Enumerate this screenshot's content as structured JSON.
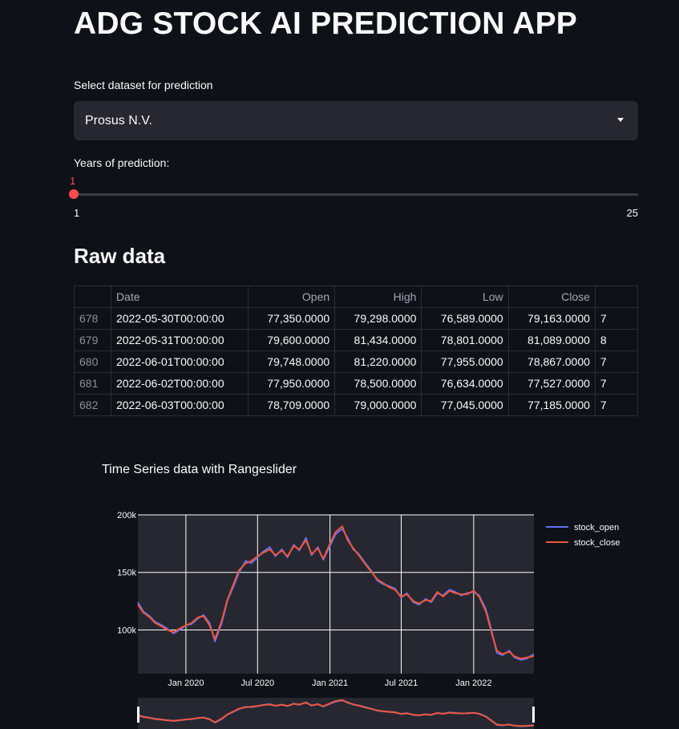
{
  "app_title": "ADG STOCK AI PREDICTION APP",
  "dataset": {
    "label": "Select dataset for prediction",
    "selected": "Prosus N.V."
  },
  "years": {
    "label": "Years of prediction:",
    "value": "1",
    "min": "1",
    "max": "25"
  },
  "raw_section": {
    "title": "Raw data"
  },
  "table": {
    "columns": [
      "",
      "Date",
      "Open",
      "High",
      "Low",
      "Close",
      ""
    ],
    "rows": [
      [
        "678",
        "2022-05-30T00:00:00",
        "77,350.0000",
        "79,298.0000",
        "76,589.0000",
        "79,163.0000",
        "7"
      ],
      [
        "679",
        "2022-05-31T00:00:00",
        "79,600.0000",
        "81,434.0000",
        "78,801.0000",
        "81,089.0000",
        "8"
      ],
      [
        "680",
        "2022-06-01T00:00:00",
        "79,748.0000",
        "81,220.0000",
        "77,955.0000",
        "78,867.0000",
        "7"
      ],
      [
        "681",
        "2022-06-02T00:00:00",
        "77,950.0000",
        "78,500.0000",
        "76,634.0000",
        "77,527.0000",
        "7"
      ],
      [
        "682",
        "2022-06-03T00:00:00",
        "78,709.0000",
        "79,000.0000",
        "77,045.0000",
        "77,185.0000",
        "7"
      ]
    ]
  },
  "chart_data": {
    "type": "line",
    "title": "Time Series data with Rangeslider",
    "x_ticks": [
      "Jan 2020",
      "Jul 2020",
      "Jan 2021",
      "Jul 2021",
      "Jan 2022"
    ],
    "y_ticks": [
      "100k",
      "150k",
      "200k"
    ],
    "ylim": [
      62000,
      200000
    ],
    "xlim": [
      "2019-09-01",
      "2022-06-03"
    ],
    "grid": true,
    "legend_position": "top-right",
    "colors": {
      "stock_open": "#636efa",
      "stock_close": "#ef553b",
      "plot_bg": "#262730"
    },
    "series": [
      {
        "name": "stock_open",
        "points": [
          [
            "2019-09-01",
            124000
          ],
          [
            "2019-09-15",
            116000
          ],
          [
            "2019-10-01",
            112000
          ],
          [
            "2019-10-15",
            107000
          ],
          [
            "2019-11-01",
            104000
          ],
          [
            "2019-11-15",
            101000
          ],
          [
            "2019-12-01",
            97000
          ],
          [
            "2019-12-15",
            100000
          ],
          [
            "2020-01-01",
            104000
          ],
          [
            "2020-01-15",
            105000
          ],
          [
            "2020-02-01",
            110000
          ],
          [
            "2020-02-15",
            113000
          ],
          [
            "2020-03-01",
            106000
          ],
          [
            "2020-03-15",
            90000
          ],
          [
            "2020-04-01",
            106000
          ],
          [
            "2020-04-15",
            125000
          ],
          [
            "2020-05-01",
            138000
          ],
          [
            "2020-05-15",
            150000
          ],
          [
            "2020-06-01",
            160000
          ],
          [
            "2020-06-15",
            158000
          ],
          [
            "2020-07-01",
            163000
          ],
          [
            "2020-07-15",
            168000
          ],
          [
            "2020-08-01",
            172000
          ],
          [
            "2020-08-15",
            164000
          ],
          [
            "2020-09-01",
            170000
          ],
          [
            "2020-09-15",
            163000
          ],
          [
            "2020-10-01",
            174000
          ],
          [
            "2020-10-15",
            169000
          ],
          [
            "2020-11-01",
            180000
          ],
          [
            "2020-11-15",
            165000
          ],
          [
            "2020-12-01",
            172000
          ],
          [
            "2020-12-15",
            161000
          ],
          [
            "2021-01-01",
            173000
          ],
          [
            "2021-01-15",
            183000
          ],
          [
            "2021-02-01",
            188000
          ],
          [
            "2021-02-15",
            180000
          ],
          [
            "2021-03-01",
            170000
          ],
          [
            "2021-03-15",
            166000
          ],
          [
            "2021-04-01",
            158000
          ],
          [
            "2021-04-15",
            152000
          ],
          [
            "2021-05-01",
            143000
          ],
          [
            "2021-05-15",
            140000
          ],
          [
            "2021-06-01",
            138000
          ],
          [
            "2021-06-15",
            136000
          ],
          [
            "2021-07-01",
            128000
          ],
          [
            "2021-07-15",
            132000
          ],
          [
            "2021-08-01",
            124000
          ],
          [
            "2021-08-15",
            122000
          ],
          [
            "2021-09-01",
            127000
          ],
          [
            "2021-09-15",
            124000
          ],
          [
            "2021-10-01",
            132000
          ],
          [
            "2021-10-15",
            130000
          ],
          [
            "2021-11-01",
            135000
          ],
          [
            "2021-11-15",
            133000
          ],
          [
            "2021-12-01",
            130000
          ],
          [
            "2021-12-15",
            132000
          ],
          [
            "2022-01-01",
            133000
          ],
          [
            "2022-01-15",
            130000
          ],
          [
            "2022-02-01",
            118000
          ],
          [
            "2022-02-15",
            100000
          ],
          [
            "2022-03-01",
            80000
          ],
          [
            "2022-03-15",
            78000
          ],
          [
            "2022-04-01",
            82000
          ],
          [
            "2022-04-15",
            76000
          ],
          [
            "2022-05-01",
            74000
          ],
          [
            "2022-05-15",
            75000
          ],
          [
            "2022-06-03",
            79000
          ]
        ]
      },
      {
        "name": "stock_close",
        "points": [
          [
            "2019-09-01",
            122000
          ],
          [
            "2019-09-15",
            115000
          ],
          [
            "2019-10-01",
            111000
          ],
          [
            "2019-10-15",
            106000
          ],
          [
            "2019-11-01",
            103000
          ],
          [
            "2019-11-15",
            100000
          ],
          [
            "2019-12-01",
            98000
          ],
          [
            "2019-12-15",
            101000
          ],
          [
            "2020-01-01",
            104000
          ],
          [
            "2020-01-15",
            106000
          ],
          [
            "2020-02-01",
            111000
          ],
          [
            "2020-02-15",
            112000
          ],
          [
            "2020-03-01",
            104000
          ],
          [
            "2020-03-15",
            92000
          ],
          [
            "2020-04-01",
            108000
          ],
          [
            "2020-04-15",
            126000
          ],
          [
            "2020-05-01",
            140000
          ],
          [
            "2020-05-15",
            152000
          ],
          [
            "2020-06-01",
            158000
          ],
          [
            "2020-06-15",
            160000
          ],
          [
            "2020-07-01",
            164000
          ],
          [
            "2020-07-15",
            167000
          ],
          [
            "2020-08-01",
            170000
          ],
          [
            "2020-08-15",
            165000
          ],
          [
            "2020-09-01",
            169000
          ],
          [
            "2020-09-15",
            164000
          ],
          [
            "2020-10-01",
            173000
          ],
          [
            "2020-10-15",
            170000
          ],
          [
            "2020-11-01",
            178000
          ],
          [
            "2020-11-15",
            166000
          ],
          [
            "2020-12-01",
            171000
          ],
          [
            "2020-12-15",
            162000
          ],
          [
            "2021-01-01",
            175000
          ],
          [
            "2021-01-15",
            185000
          ],
          [
            "2021-02-01",
            190000
          ],
          [
            "2021-02-15",
            178000
          ],
          [
            "2021-03-01",
            171000
          ],
          [
            "2021-03-15",
            165000
          ],
          [
            "2021-04-01",
            157000
          ],
          [
            "2021-04-15",
            151000
          ],
          [
            "2021-05-01",
            144000
          ],
          [
            "2021-05-15",
            141000
          ],
          [
            "2021-06-01",
            137000
          ],
          [
            "2021-06-15",
            135000
          ],
          [
            "2021-07-01",
            129000
          ],
          [
            "2021-07-15",
            131000
          ],
          [
            "2021-08-01",
            125000
          ],
          [
            "2021-08-15",
            123000
          ],
          [
            "2021-09-01",
            126000
          ],
          [
            "2021-09-15",
            125000
          ],
          [
            "2021-10-01",
            133000
          ],
          [
            "2021-10-15",
            129000
          ],
          [
            "2021-11-01",
            134000
          ],
          [
            "2021-11-15",
            132000
          ],
          [
            "2021-12-01",
            131000
          ],
          [
            "2021-12-15",
            131000
          ],
          [
            "2022-01-01",
            134000
          ],
          [
            "2022-01-15",
            129000
          ],
          [
            "2022-02-01",
            116000
          ],
          [
            "2022-02-15",
            98000
          ],
          [
            "2022-03-01",
            82000
          ],
          [
            "2022-03-15",
            79000
          ],
          [
            "2022-04-01",
            81000
          ],
          [
            "2022-04-15",
            77000
          ],
          [
            "2022-05-01",
            75000
          ],
          [
            "2022-05-15",
            76000
          ],
          [
            "2022-06-03",
            77185
          ]
        ]
      }
    ]
  }
}
